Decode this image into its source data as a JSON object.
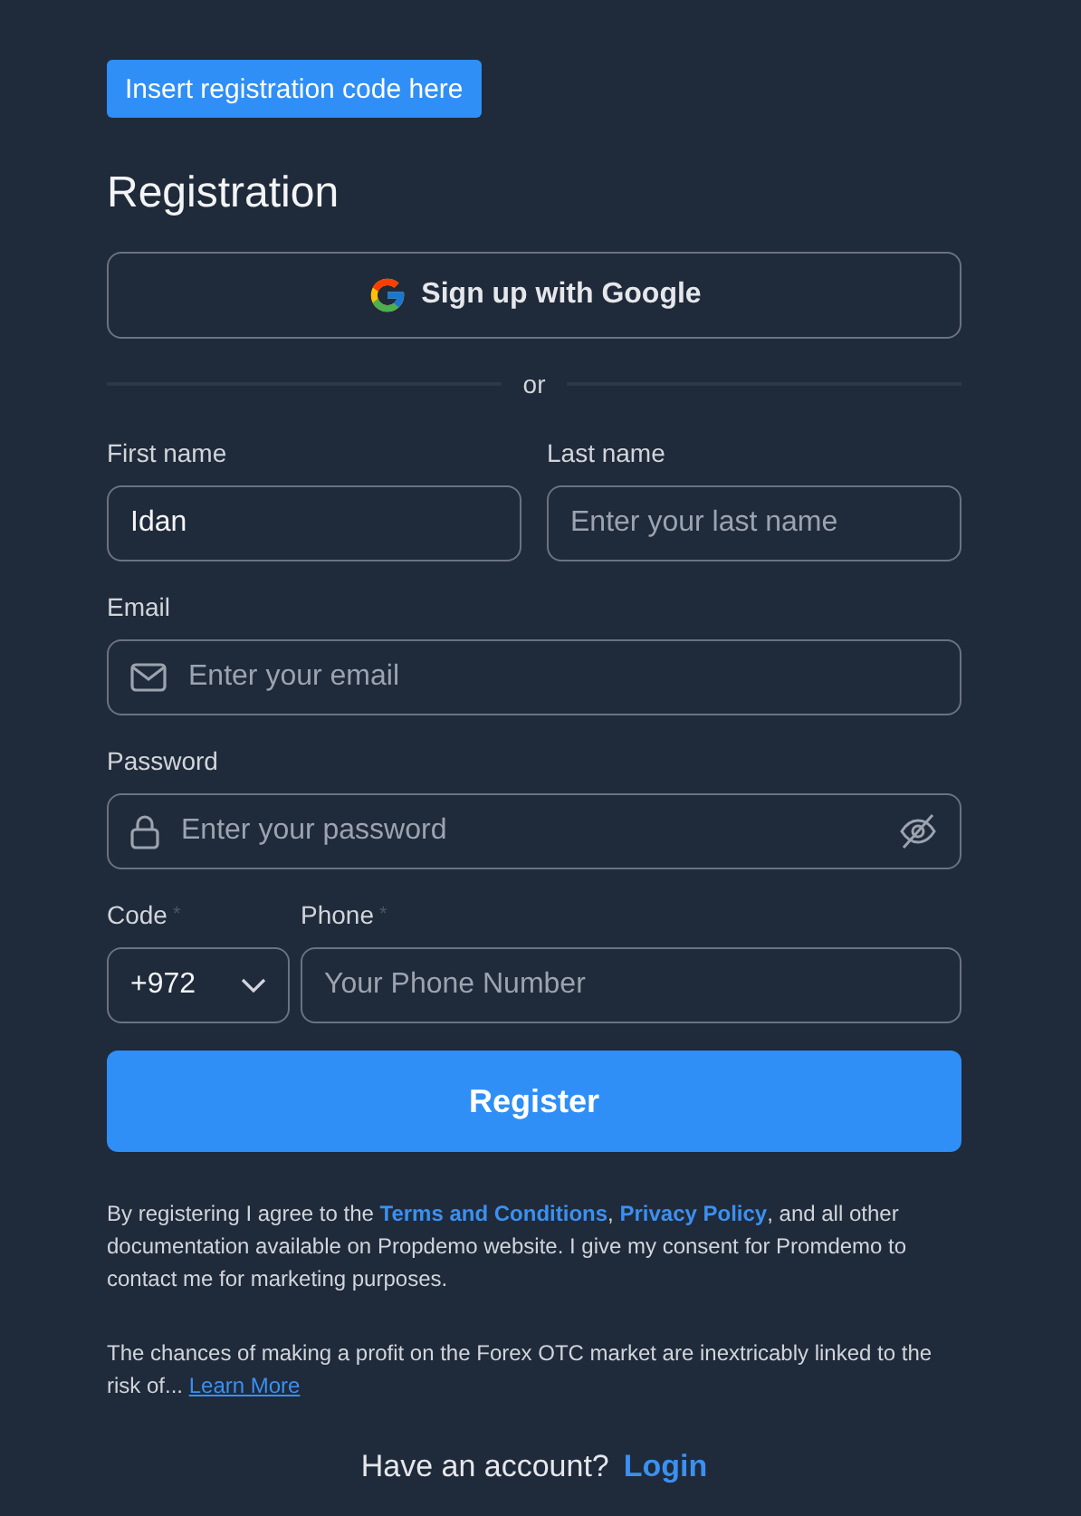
{
  "code_button": "Insert registration code here",
  "title": "Registration",
  "google_button": "Sign up with Google",
  "divider": "or",
  "first_name": {
    "label": "First name",
    "value": "Idan"
  },
  "last_name": {
    "label": "Last name",
    "placeholder": "Enter your last name"
  },
  "email": {
    "label": "Email",
    "placeholder": "Enter your email"
  },
  "password": {
    "label": "Password",
    "placeholder": "Enter your password"
  },
  "code": {
    "label": "Code",
    "required": "*",
    "value": "+972"
  },
  "phone": {
    "label": "Phone",
    "required": "*",
    "placeholder": "Your Phone Number"
  },
  "register_button": "Register",
  "consent": [
    {
      "kind": "plain",
      "text": "By registering I agree to the "
    },
    {
      "kind": "link",
      "text": "Terms and Conditions"
    },
    {
      "kind": "plain",
      "text": ", "
    },
    {
      "kind": "link",
      "text": "Privacy Policy"
    },
    {
      "kind": "plain",
      "text": ", and all other documentation available on Propdemo website. I give my consent for Promdemo to contact me for marketing purposes."
    }
  ],
  "risk": {
    "text": "The chances of making a profit on the Forex OTC market are inextricably linked to the risk of...",
    "link": "Learn More"
  },
  "account": {
    "text": "Have an account?",
    "link": "Login"
  }
}
